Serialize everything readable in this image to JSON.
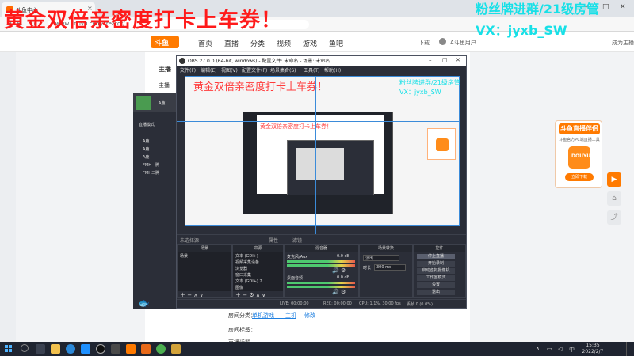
{
  "browser": {
    "tab_title": "斗鱼中心",
    "address": "www.douyu.com/creator/",
    "tab_close": "×",
    "win_min": "–",
    "win_max": "□",
    "win_close": "✕"
  },
  "overlay": {
    "red_text": "黄金双倍亲密度打卡上车券！",
    "cyan_line1": "粉丝牌进群/21级房管",
    "cyan_line2": "VX：jyxb_SW"
  },
  "douyu": {
    "logo_text": "斗鱼",
    "nav": [
      "首页",
      "直播",
      "分类",
      "视频",
      "游戏",
      "鱼吧"
    ],
    "download_label": "下载",
    "user_label": "A斗鱼用户",
    "anchor_label": "成为主播",
    "card_lines": [
      "主播",
      "主播",
      "房间分类：",
      "房间标签：",
      "直播话题"
    ],
    "link_label": "单机游戏——主机",
    "change_label": "修改"
  },
  "float_card": {
    "title": "斗鱼直播伴侣",
    "desc": "斗鱼官方PC端直播工具",
    "app_label": "DOUYU",
    "button": "立即下载"
  },
  "side_buttons": [
    "▶",
    "⌂",
    "⤴"
  ],
  "obs": {
    "title": "OBS 27.0.0 (64-bit, windows) - 配置文件: 未命名 - 场景: 未命名",
    "menu": [
      "文件(F)",
      "编辑(E)",
      "视图(V)",
      "配置文件(P)",
      "场景集合(S)",
      "工具(T)",
      "帮助(H)"
    ],
    "no_source": "未选择源",
    "properties": "属性",
    "filters": "滤镜",
    "docks": {
      "scenes": {
        "title": "场景",
        "items": [
          "场景"
        ]
      },
      "sources": {
        "title": "来源",
        "items": [
          "文本 (GDI+)",
          "视频采集设备",
          "浏览器",
          "窗口采集",
          "文本 (GDI+) 2",
          "图像"
        ]
      },
      "mixer": {
        "title": "混音器",
        "channels": [
          {
            "name": "麦克风/Aux",
            "db": "0.0 dB"
          },
          {
            "name": "桌面音频",
            "db": "0.0 dB"
          }
        ]
      },
      "transitions": {
        "title": "场景转换",
        "type": "淡出",
        "duration_label": "时长",
        "duration": "300 ms"
      },
      "controls": {
        "title": "控件",
        "buttons": [
          "停止直播",
          "开始录制",
          "启动虚拟摄像机",
          "工作室模式",
          "设置",
          "退出"
        ]
      }
    },
    "footer": {
      "drops": "丢帧 0 (0.0%)",
      "live": "LIVE: 00:00:00",
      "rec": "REC: 00:00:00",
      "cpu": "CPU: 1.1%, 30.00 fps",
      "kbps": "kb/s: 0"
    }
  },
  "preview_bg_left": {
    "user": "A鹿",
    "items": [
      "直播模式",
      "A鹿",
      "A鹿",
      "A鹿",
      "A鹿",
      "A鹿",
      "FMH—腾",
      "FMH二腾"
    ]
  },
  "taskbar": {
    "time": "15:35",
    "date": "2022/2/7"
  }
}
